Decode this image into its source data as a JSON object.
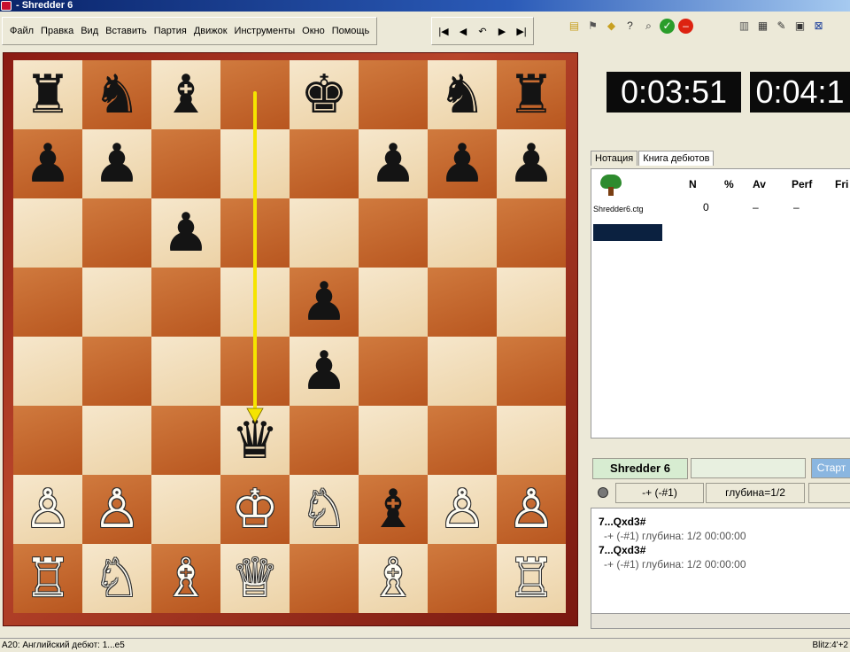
{
  "window": {
    "title": "- Shredder 6"
  },
  "menu": {
    "items": [
      "Файл",
      "Правка",
      "Вид",
      "Вставить",
      "Партия",
      "Движок",
      "Инструменты",
      "Окно",
      "Помощь"
    ]
  },
  "nav": {
    "buttons": [
      "|◀",
      "◀",
      "↶",
      "▶",
      "▶|"
    ]
  },
  "toolbar_icons": {
    "group1": [
      "new-icon",
      "flag-icon",
      "hint-icon",
      "help-icon",
      "analyze-icon",
      "ok-icon",
      "stop-icon"
    ],
    "group2": [
      "book-icon",
      "board-icon",
      "edit-icon",
      "window-icon",
      "close-icon"
    ]
  },
  "board": {
    "squares": [
      [
        "♜",
        "♞",
        "♝",
        "",
        "♚",
        "",
        "♞",
        "♜"
      ],
      [
        "♟",
        "♟",
        "",
        "",
        "",
        "♟",
        "♟",
        "♟"
      ],
      [
        "",
        "",
        "♟",
        "",
        "",
        "",
        "",
        ""
      ],
      [
        "",
        "",
        "",
        "",
        "♟",
        "",
        "",
        ""
      ],
      [
        "",
        "",
        "",
        "",
        "♟",
        "",
        "",
        ""
      ],
      [
        "",
        "",
        "",
        "♛",
        "",
        "",
        "",
        ""
      ],
      [
        "♙",
        "♙",
        "",
        "♔",
        "♘",
        "♝",
        "♙",
        "♙"
      ],
      [
        "♖",
        "♘",
        "♗",
        "♕",
        "",
        "♗",
        "",
        "♖"
      ]
    ],
    "colors": [
      [
        "b",
        "b",
        "b",
        "",
        "b",
        "",
        "b",
        "b"
      ],
      [
        "b",
        "b",
        "",
        "",
        "",
        "b",
        "b",
        "b"
      ],
      [
        "",
        "",
        "b",
        "",
        "",
        "",
        "",
        ""
      ],
      [
        "",
        "",
        "",
        "",
        "b",
        "",
        "",
        ""
      ],
      [
        "",
        "",
        "",
        "",
        "b",
        "",
        "",
        ""
      ],
      [
        "",
        "",
        "",
        "b",
        "",
        "",
        "",
        ""
      ],
      [
        "w",
        "w",
        "",
        "w",
        "w",
        "b",
        "w",
        "w"
      ],
      [
        "w",
        "w",
        "w",
        "w",
        "",
        "w",
        "",
        "w"
      ]
    ],
    "arrow": {
      "from": "d8",
      "to": "d3",
      "color": "#f5e400"
    }
  },
  "clocks": {
    "white": "0:03:51",
    "black": "0:04:1"
  },
  "tabs": [
    {
      "label": "Нотация"
    },
    {
      "label": "Книга дебютов"
    }
  ],
  "book": {
    "headers": [
      "N",
      "%",
      "Av",
      "Perf",
      "Fri"
    ],
    "file": "Shredder6.ctg",
    "values": [
      "0",
      "–",
      "–"
    ]
  },
  "engine": {
    "name": "Shredder 6",
    "start_label": "Старт",
    "eval": "-+ (-#1)",
    "depth": "глубина=1/2",
    "lines": [
      {
        "move": "7...Qxd3#",
        "info": "-+  (-#1)    глубина: 1/2    00:00:00"
      },
      {
        "move": "7...Qxd3#",
        "info": "-+  (-#1)    глубина: 1/2    00:00:00"
      }
    ]
  },
  "status": {
    "left": "A20: Английский дебют: 1...e5",
    "right": "Blitz:4'+2"
  }
}
